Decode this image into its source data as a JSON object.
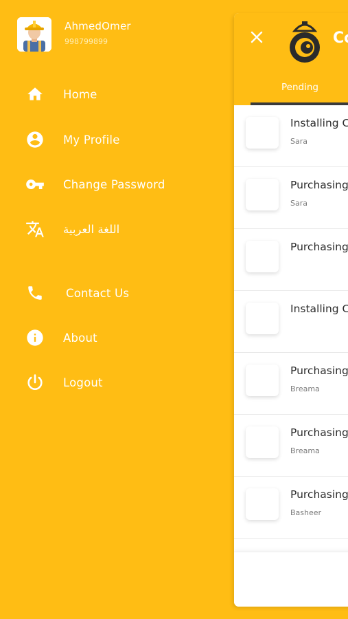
{
  "profile": {
    "name": "AhmedOmer",
    "phone": "998799899"
  },
  "menu": [
    {
      "label": "Home",
      "icon": "home-icon"
    },
    {
      "label": "My Profile",
      "icon": "account-circle-icon"
    },
    {
      "label": "Change Password",
      "icon": "key-icon"
    },
    {
      "label": "اللغة العربية",
      "icon": "translate-icon"
    },
    {
      "label": "Contact Us",
      "icon": "phone-icon"
    },
    {
      "label": "About",
      "icon": "info-icon"
    },
    {
      "label": "Logout",
      "icon": "power-icon"
    }
  ],
  "header": {
    "title": "Co",
    "tab": "Pending"
  },
  "orders": [
    {
      "title": "Installing C",
      "customer": "Sara"
    },
    {
      "title": "Purchasing",
      "customer": "Sara"
    },
    {
      "title": "Purchasing",
      "customer": ""
    },
    {
      "title": "Installing C",
      "customer": ""
    },
    {
      "title": "Purchasing",
      "customer": "Breama"
    },
    {
      "title": "Purchasing",
      "customer": "Breama"
    },
    {
      "title": "Purchasing",
      "customer": "Basheer"
    }
  ],
  "colors": {
    "accent": "#FFBD14",
    "tab_underline": "#3a3a3a"
  }
}
